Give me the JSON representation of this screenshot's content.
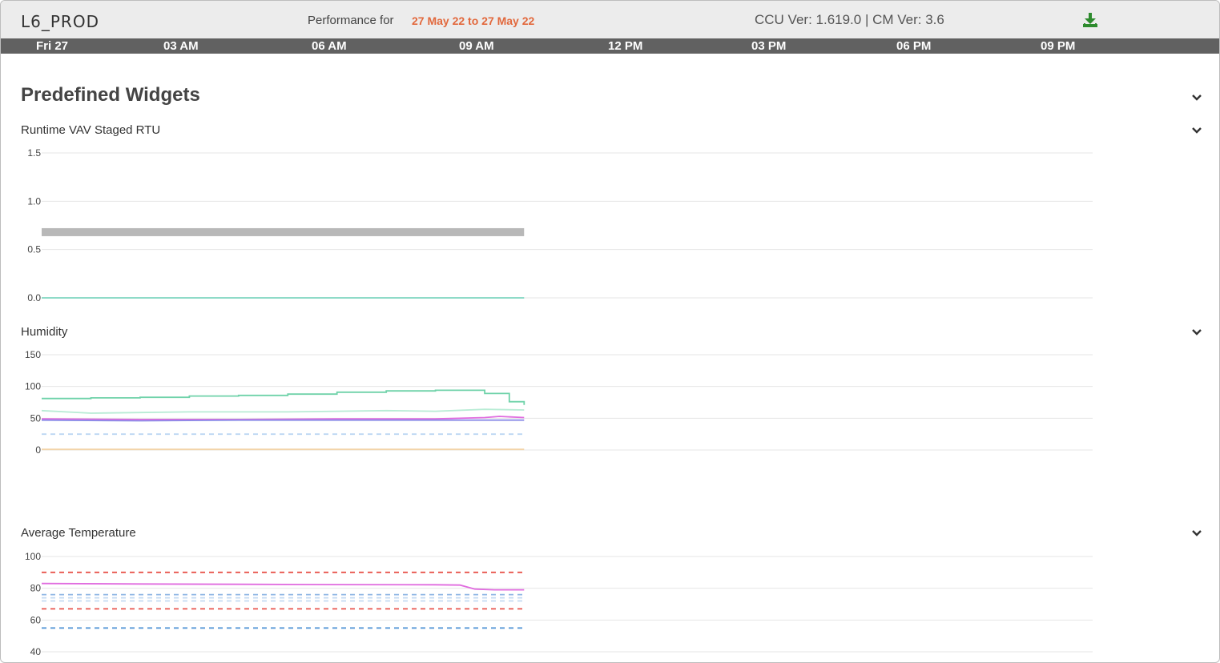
{
  "header": {
    "site_name": "L6_PROD",
    "performance_label": "Performance for",
    "date_range": "27 May 22 to 27 May 22",
    "versions": "CCU Ver: 1.619.0 | CM Ver: 3.6",
    "download_icon": "download-icon"
  },
  "timeline": {
    "ticks": [
      "Fri 27",
      "03 AM",
      "06 AM",
      "09 AM",
      "12 PM",
      "03 PM",
      "06 PM",
      "09 PM"
    ]
  },
  "section": {
    "title": "Predefined Widgets",
    "collapse_icon": "chevron-down-icon"
  },
  "colors": {
    "accent_orange": "#e2683c",
    "download_green": "#2e8b2e",
    "timebar": "#616161"
  },
  "chart_data": [
    {
      "type": "line",
      "title": "Runtime VAV Staged RTU",
      "ylim": [
        0,
        1.5
      ],
      "yticks": [
        "1.5",
        "1.0",
        "0.5",
        "0.0"
      ],
      "x_range": [
        "00:00",
        "24:00"
      ],
      "data_end": "09:50",
      "series": [
        {
          "color": "#b8b8b8",
          "style": "band",
          "values": [
            [
              0,
              0.68
            ],
            [
              9.8,
              0.68
            ]
          ]
        },
        {
          "color": "#7fd6c0",
          "style": "solid",
          "values": [
            [
              0,
              0.0
            ],
            [
              9.8,
              0.0
            ]
          ]
        }
      ]
    },
    {
      "type": "line",
      "title": "Humidity",
      "ylim": [
        0,
        150
      ],
      "yticks": [
        "150",
        "100",
        "50",
        "0"
      ],
      "x_range": [
        "00:00",
        "24:00"
      ],
      "data_end": "09:50",
      "series": [
        {
          "color": "#6fd2a9",
          "style": "step",
          "values": [
            [
              0,
              81
            ],
            [
              1,
              82
            ],
            [
              2,
              83
            ],
            [
              3,
              85
            ],
            [
              4,
              86
            ],
            [
              5,
              88
            ],
            [
              6,
              91
            ],
            [
              7,
              93
            ],
            [
              8,
              94
            ],
            [
              9,
              89
            ],
            [
              9.5,
              76
            ],
            [
              9.8,
              71
            ]
          ]
        },
        {
          "color": "#b8ecd5",
          "style": "solid",
          "values": [
            [
              0,
              62
            ],
            [
              1,
              58
            ],
            [
              2,
              59
            ],
            [
              3,
              60
            ],
            [
              4,
              60
            ],
            [
              5,
              60
            ],
            [
              6,
              61
            ],
            [
              7,
              62
            ],
            [
              8,
              61
            ],
            [
              9,
              64
            ],
            [
              9.8,
              63
            ]
          ]
        },
        {
          "color": "#e06bdf",
          "style": "solid",
          "values": [
            [
              0,
              49
            ],
            [
              2,
              48
            ],
            [
              4,
              48
            ],
            [
              6,
              49
            ],
            [
              8,
              49
            ],
            [
              9,
              51
            ],
            [
              9.3,
              53
            ],
            [
              9.8,
              51
            ]
          ]
        },
        {
          "color": "#8b8ce8",
          "style": "solid",
          "values": [
            [
              0,
              47
            ],
            [
              2,
              46
            ],
            [
              4,
              47
            ],
            [
              6,
              47
            ],
            [
              8,
              47
            ],
            [
              9.8,
              47
            ]
          ]
        },
        {
          "color": "#bcd6f3",
          "style": "dashed",
          "values": [
            [
              0,
              25
            ],
            [
              9.8,
              25
            ]
          ]
        },
        {
          "color": "#f3d4a8",
          "style": "solid",
          "values": [
            [
              0,
              1
            ],
            [
              9.8,
              1
            ]
          ]
        }
      ]
    },
    {
      "type": "line",
      "title": "Average Temperature",
      "ylim": [
        40,
        100
      ],
      "yticks": [
        "100",
        "80",
        "60",
        "40"
      ],
      "x_range": [
        "00:00",
        "24:00"
      ],
      "data_end": "09:50",
      "series": [
        {
          "color": "#e8544c",
          "style": "dashed",
          "values": [
            [
              0,
              90
            ],
            [
              9.8,
              90
            ]
          ]
        },
        {
          "color": "#e06bdf",
          "style": "solid",
          "values": [
            [
              0,
              83
            ],
            [
              2,
              82.7
            ],
            [
              4,
              82.5
            ],
            [
              6,
              82.3
            ],
            [
              8,
              82.2
            ],
            [
              8.5,
              82
            ],
            [
              8.8,
              79.5
            ],
            [
              9.2,
              79
            ],
            [
              9.8,
              79
            ]
          ]
        },
        {
          "color": "#8fb6e4",
          "style": "dashed",
          "values": [
            [
              0,
              76
            ],
            [
              9.8,
              76
            ]
          ]
        },
        {
          "color": "#c3daf2",
          "style": "dashed",
          "values": [
            [
              0,
              74
            ],
            [
              9.8,
              74
            ]
          ]
        },
        {
          "color": "#c3daf2",
          "style": "dashed",
          "values": [
            [
              0,
              72
            ],
            [
              9.8,
              72
            ]
          ]
        },
        {
          "color": "#e8544c",
          "style": "dashed",
          "values": [
            [
              0,
              67
            ],
            [
              9.8,
              67
            ]
          ]
        },
        {
          "color": "#5b9ad8",
          "style": "dashed",
          "values": [
            [
              0,
              55
            ],
            [
              9.8,
              55
            ]
          ]
        }
      ]
    }
  ]
}
